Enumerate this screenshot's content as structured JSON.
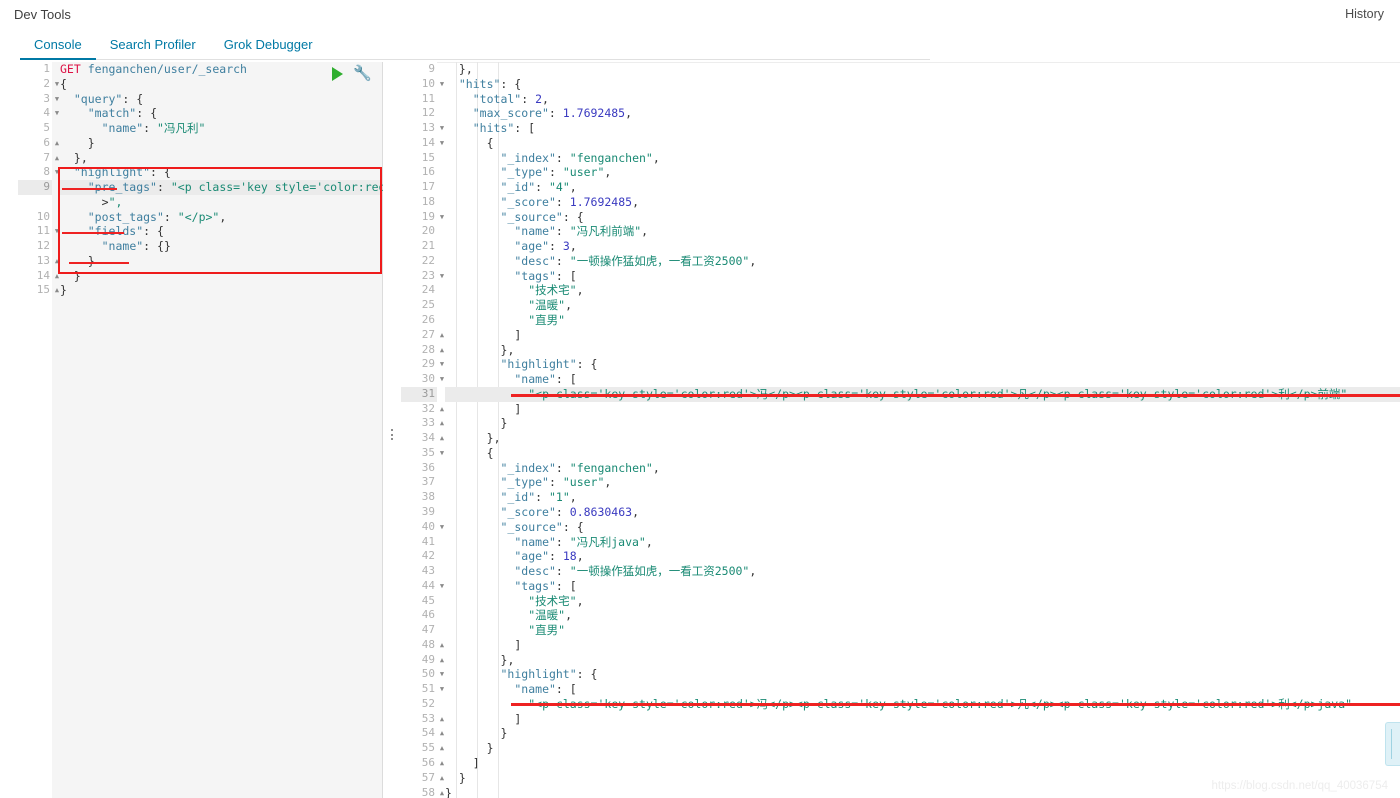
{
  "header": {
    "app_title": "Dev Tools",
    "history_label": "History"
  },
  "tabs": [
    {
      "label": "Console",
      "active": true
    },
    {
      "label": "Search Profiler",
      "active": false
    },
    {
      "label": "Grok Debugger",
      "active": false
    }
  ],
  "toolbar": {
    "play_icon": "play-icon",
    "wrench_icon": "wrench-icon"
  },
  "request_editor": {
    "method": "GET",
    "path": "fenganchen/user/_search",
    "first_line_number": 1,
    "current_line": 9,
    "lines": [
      {
        "n": 1,
        "fold": "",
        "text": "GET fenganchen/user/_search"
      },
      {
        "n": 2,
        "fold": "down",
        "text": "{"
      },
      {
        "n": 3,
        "fold": "down",
        "text": "  \"query\": {"
      },
      {
        "n": 4,
        "fold": "down",
        "text": "    \"match\": {"
      },
      {
        "n": 5,
        "fold": "",
        "text": "      \"name\": \"冯凡利\""
      },
      {
        "n": 6,
        "fold": "up",
        "text": "    }"
      },
      {
        "n": 7,
        "fold": "up",
        "text": "  },"
      },
      {
        "n": 8,
        "fold": "down",
        "text": "  \"highlight\": {"
      },
      {
        "n": 9,
        "fold": "",
        "text": "    \"pre_tags\": \"<p class='key style='color:red'"
      },
      {
        "n": "",
        "fold": "",
        "text": "      >\","
      },
      {
        "n": 10,
        "fold": "",
        "text": "    \"post_tags\": \"</p>\","
      },
      {
        "n": 11,
        "fold": "down",
        "text": "    \"fields\": {"
      },
      {
        "n": 12,
        "fold": "",
        "text": "      \"name\": {}"
      },
      {
        "n": 13,
        "fold": "up",
        "text": "    }"
      },
      {
        "n": 14,
        "fold": "up",
        "text": "  }"
      },
      {
        "n": 15,
        "fold": "up",
        "text": "}"
      }
    ]
  },
  "response_editor": {
    "current_line": 31,
    "lines": [
      {
        "n": 9,
        "fold": "",
        "text": "  },"
      },
      {
        "n": 10,
        "fold": "down",
        "text": "  \"hits\": {"
      },
      {
        "n": 11,
        "fold": "",
        "text": "    \"total\": 2,"
      },
      {
        "n": 12,
        "fold": "",
        "text": "    \"max_score\": 1.7692485,"
      },
      {
        "n": 13,
        "fold": "down",
        "text": "    \"hits\": ["
      },
      {
        "n": 14,
        "fold": "down",
        "text": "      {"
      },
      {
        "n": 15,
        "fold": "",
        "text": "        \"_index\": \"fenganchen\","
      },
      {
        "n": 16,
        "fold": "",
        "text": "        \"_type\": \"user\","
      },
      {
        "n": 17,
        "fold": "",
        "text": "        \"_id\": \"4\","
      },
      {
        "n": 18,
        "fold": "",
        "text": "        \"_score\": 1.7692485,"
      },
      {
        "n": 19,
        "fold": "down",
        "text": "        \"_source\": {"
      },
      {
        "n": 20,
        "fold": "",
        "text": "          \"name\": \"冯凡利前端\","
      },
      {
        "n": 21,
        "fold": "",
        "text": "          \"age\": 3,"
      },
      {
        "n": 22,
        "fold": "",
        "text": "          \"desc\": \"一顿操作猛如虎，一看工资2500\","
      },
      {
        "n": 23,
        "fold": "down",
        "text": "          \"tags\": ["
      },
      {
        "n": 24,
        "fold": "",
        "text": "            \"技术宅\","
      },
      {
        "n": 25,
        "fold": "",
        "text": "            \"温暖\","
      },
      {
        "n": 26,
        "fold": "",
        "text": "            \"直男\""
      },
      {
        "n": 27,
        "fold": "up",
        "text": "          ]"
      },
      {
        "n": 28,
        "fold": "up",
        "text": "        },"
      },
      {
        "n": 29,
        "fold": "down",
        "text": "        \"highlight\": {"
      },
      {
        "n": 30,
        "fold": "down",
        "text": "          \"name\": ["
      },
      {
        "n": 31,
        "fold": "",
        "text": "            \"<p class='key style='color:red'>冯</p><p class='key style='color:red'>凡</p><p class='key style='color:red'>利</p>前端\""
      },
      {
        "n": 32,
        "fold": "up",
        "text": "          ]"
      },
      {
        "n": 33,
        "fold": "up",
        "text": "        }"
      },
      {
        "n": 34,
        "fold": "up",
        "text": "      },"
      },
      {
        "n": 35,
        "fold": "down",
        "text": "      {"
      },
      {
        "n": 36,
        "fold": "",
        "text": "        \"_index\": \"fenganchen\","
      },
      {
        "n": 37,
        "fold": "",
        "text": "        \"_type\": \"user\","
      },
      {
        "n": 38,
        "fold": "",
        "text": "        \"_id\": \"1\","
      },
      {
        "n": 39,
        "fold": "",
        "text": "        \"_score\": 0.8630463,"
      },
      {
        "n": 40,
        "fold": "down",
        "text": "        \"_source\": {"
      },
      {
        "n": 41,
        "fold": "",
        "text": "          \"name\": \"冯凡利java\","
      },
      {
        "n": 42,
        "fold": "",
        "text": "          \"age\": 18,"
      },
      {
        "n": 43,
        "fold": "",
        "text": "          \"desc\": \"一顿操作猛如虎，一看工资2500\","
      },
      {
        "n": 44,
        "fold": "down",
        "text": "          \"tags\": ["
      },
      {
        "n": 45,
        "fold": "",
        "text": "            \"技术宅\","
      },
      {
        "n": 46,
        "fold": "",
        "text": "            \"温暖\","
      },
      {
        "n": 47,
        "fold": "",
        "text": "            \"直男\""
      },
      {
        "n": 48,
        "fold": "up",
        "text": "          ]"
      },
      {
        "n": 49,
        "fold": "up",
        "text": "        },"
      },
      {
        "n": 50,
        "fold": "down",
        "text": "        \"highlight\": {"
      },
      {
        "n": 51,
        "fold": "down",
        "text": "          \"name\": ["
      },
      {
        "n": 52,
        "fold": "",
        "text": "            \"<p class='key style='color:red'>冯</p><p class='key style='color:red'>凡</p><p class='key style='color:red'>利</p>java\""
      },
      {
        "n": 53,
        "fold": "up",
        "text": "          ]"
      },
      {
        "n": 54,
        "fold": "up",
        "text": "        }"
      },
      {
        "n": 55,
        "fold": "up",
        "text": "      }"
      },
      {
        "n": 56,
        "fold": "up",
        "text": "    ]"
      },
      {
        "n": 57,
        "fold": "up",
        "text": "  }"
      },
      {
        "n": 58,
        "fold": "up",
        "text": "}"
      }
    ]
  },
  "annotations": {
    "highlight_box_label": "highlight-block-callout",
    "underlines": [
      "pre_tags",
      "post_tags",
      "name"
    ],
    "color": "#ee2222"
  },
  "watermark": {
    "text": "https://blog.csdn.net/qq_40036754"
  }
}
